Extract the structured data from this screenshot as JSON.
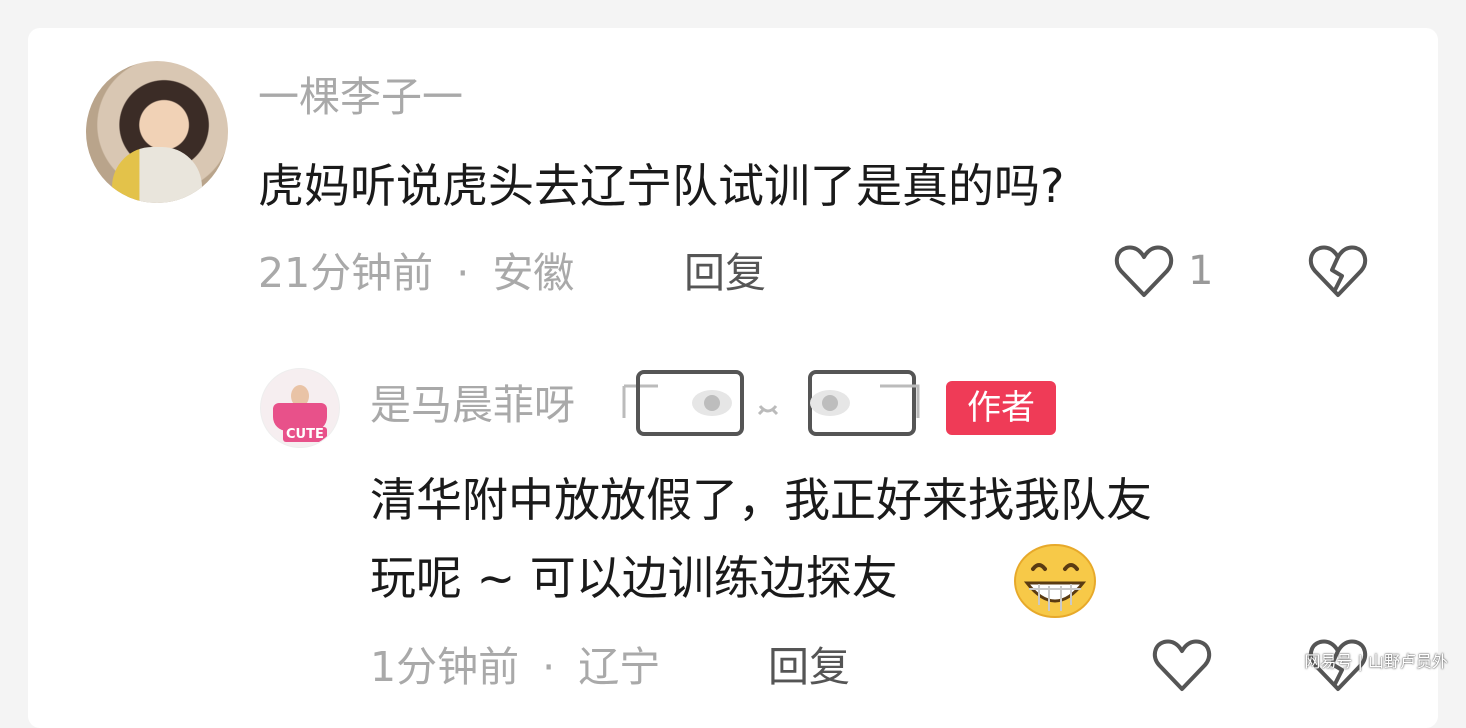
{
  "comment": {
    "username": "一棵李子一",
    "text": "虎妈听说虎头去辽宁队试训了是真的吗?",
    "time": "21分钟前",
    "separator": "·",
    "location": "安徽",
    "reply_label": "回复",
    "like_count": "1",
    "icons": [
      "heart-icon",
      "broken-heart-icon"
    ]
  },
  "reply": {
    "username": "是马晨菲呀",
    "username_deco": "⌐ 👁ᴗ👁 ⌐",
    "badge": "作者",
    "text_line1": "清华附中放放假了，我正好来找我队友",
    "text_line2": "玩呢 ~ 可以边训练边探友",
    "emoji": "grinning-face-icon",
    "time": "1分钟前",
    "separator": "·",
    "location": "辽宁",
    "reply_label": "回复",
    "icons": [
      "heart-icon",
      "broken-heart-icon"
    ]
  },
  "watermark": "网易号 | 山野卢员外",
  "colors": {
    "badge_bg": "#ef3b57",
    "text_primary": "#1a1a1a",
    "text_secondary": "#a9a9a9"
  }
}
